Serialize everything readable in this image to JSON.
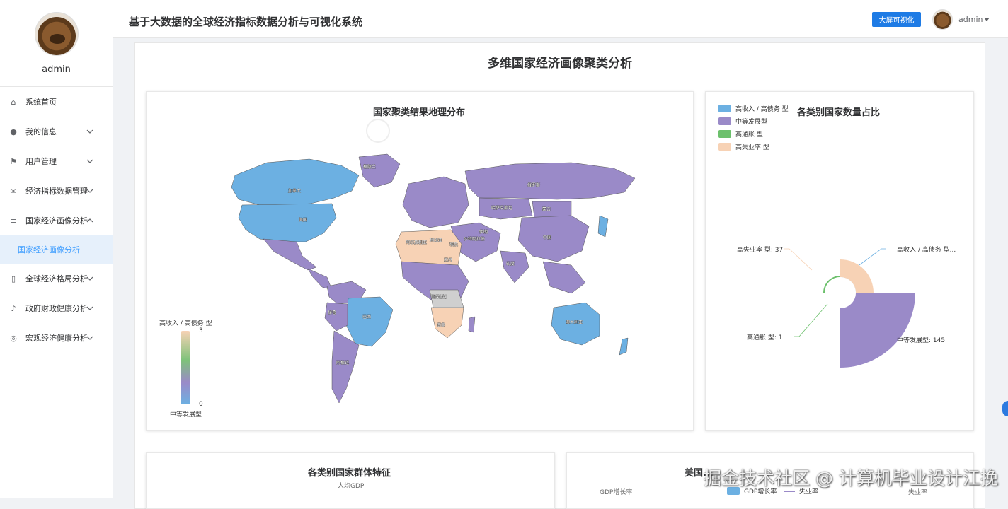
{
  "user": {
    "name": "admin"
  },
  "sidebar": {
    "items": [
      {
        "label": "系统首页",
        "icon": "home-icon",
        "glyph": "⌂",
        "chevron": false
      },
      {
        "label": "我的信息",
        "icon": "user-icon",
        "glyph": "●",
        "chevron": true
      },
      {
        "label": "用户管理",
        "icon": "flag-icon",
        "glyph": "⚑",
        "chevron": true
      },
      {
        "label": "经济指标数据管理",
        "icon": "mail-icon",
        "glyph": "✉",
        "chevron": true
      },
      {
        "label": "国家经济画像分析",
        "icon": "sliders-icon",
        "glyph": "≡",
        "chevron": true,
        "expanded": true
      },
      {
        "label": "全球经济格局分析",
        "icon": "phone-icon",
        "glyph": "▯",
        "chevron": true
      },
      {
        "label": "政府财政健康分析",
        "icon": "microphone-icon",
        "glyph": "♪",
        "chevron": true
      },
      {
        "label": "宏观经济健康分析",
        "icon": "circle-icon",
        "glyph": "◎",
        "chevron": true
      }
    ],
    "active_sub": "国家经济画像分析"
  },
  "header": {
    "title": "基于大数据的全球经济指标数据分析与可视化系统",
    "bigscreen_label": "大屏可视化",
    "username": "admin"
  },
  "panel": {
    "title": "多维国家经济画像聚类分析"
  },
  "map_card": {
    "title": "国家聚类结果地理分布",
    "visualmap": {
      "max": "3",
      "min": "0",
      "top_label": "高收入 / 高债务 型",
      "bottom_label": "中等发展型",
      "colors": [
        "#f7d2b5",
        "#7ec27a",
        "#9a8ac8",
        "#6cb0e2"
      ]
    },
    "country_labels": [
      "格陵兰",
      "加拿大",
      "美国",
      "俄罗斯",
      "哈萨克斯坦",
      "蒙古",
      "中国",
      "巴西",
      "澳大利亚",
      "印度",
      "阿尔及利亚",
      "利比亚",
      "埃及",
      "苏丹",
      "刚果(金)",
      "南非",
      "阿根廷",
      "秘鲁",
      "沙特阿拉伯",
      "伊朗"
    ]
  },
  "pie_card": {
    "title": "各类别国家数量占比",
    "legend": [
      {
        "label": "高收入 / 高债务 型",
        "color": "#6cb0e2"
      },
      {
        "label": "中等发展型",
        "color": "#9a8ac8"
      },
      {
        "label": "高通胀 型",
        "color": "#6cc06c"
      },
      {
        "label": "高失业率 型",
        "color": "#f7d2b5"
      }
    ],
    "labels": [
      {
        "text": "高失业率 型: 37"
      },
      {
        "text": "高收入 / 高债务 型..."
      },
      {
        "text": "高通胀 型: 1"
      },
      {
        "text": "中等发展型: 145"
      }
    ]
  },
  "chart_data": {
    "type": "pie",
    "title": "各类别国家数量占比",
    "rose": true,
    "categories": [
      "高收入 / 高债务 型",
      "中等发展型",
      "高通胀 型",
      "高失业率 型"
    ],
    "values": [
      null,
      145,
      1,
      37
    ],
    "colors": [
      "#6cb0e2",
      "#9a8ac8",
      "#6cc06c",
      "#f7d2b5"
    ],
    "legend_position": "top-left"
  },
  "bottom_left": {
    "title": "各类别国家群体特征",
    "axis_label": "人均GDP"
  },
  "bottom_right": {
    "title": "美国...",
    "legend_gdp": "GDP增长率",
    "legend_unemp": "失业率",
    "axis_left": "GDP增长率",
    "axis_right": "失业率"
  },
  "watermark": "掘金技术社区 @ 计算机毕业设计江挽"
}
